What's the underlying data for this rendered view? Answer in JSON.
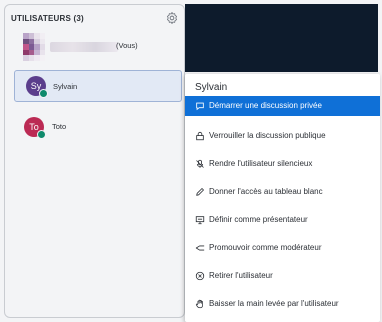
{
  "users_panel": {
    "title": "UTILISATEURS (3)",
    "settings_icon": "gear-icon",
    "users": [
      {
        "name_suffix": "(Vous)",
        "is_current_user": true
      },
      {
        "initials": "Sy",
        "name": "Sylvain",
        "avatar_color": "#5b3e8c",
        "selected": true
      },
      {
        "initials": "To",
        "name": "Toto",
        "avatar_color": "#bb2a54"
      }
    ]
  },
  "context_menu": {
    "title": "Sylvain",
    "items": [
      {
        "label": "Démarrer une discussion privée",
        "icon": "chat-bubble-icon",
        "active": true
      },
      {
        "label": "Verrouiller la discussion publique",
        "icon": "lock-icon"
      },
      {
        "label": "Rendre l'utilisateur silencieux",
        "icon": "mic-mute-icon"
      },
      {
        "label": "Donner l'accès au tableau blanc",
        "icon": "pencil-icon"
      },
      {
        "label": "Définir comme présentateur",
        "icon": "presentation-icon"
      },
      {
        "label": "Promouvoir comme modérateur",
        "icon": "promote-icon"
      },
      {
        "label": "Retirer l'utilisateur",
        "icon": "remove-circle-icon"
      },
      {
        "label": "Baisser la main levée par l'utilisateur",
        "icon": "hand-icon"
      }
    ]
  },
  "colors": {
    "accent": "#0f70d7",
    "video_area": "#0d1b2c",
    "mic_badge": "#0f8a6c"
  }
}
